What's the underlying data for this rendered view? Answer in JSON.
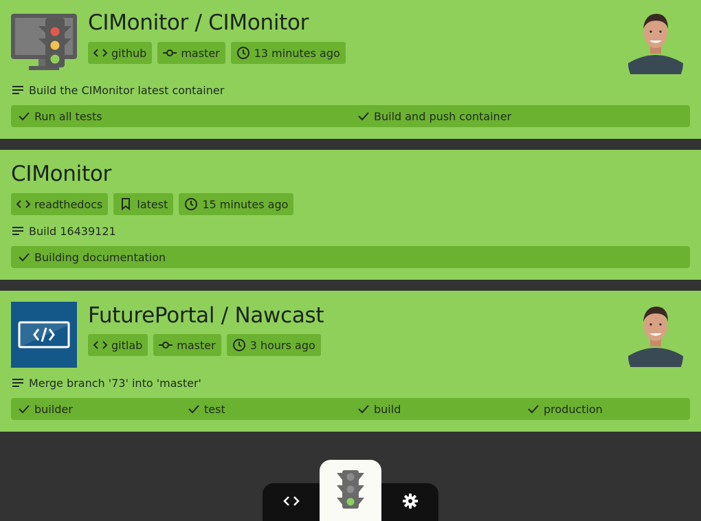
{
  "colors": {
    "card_bg": "#8fd05b",
    "chip_bg": "#6cb231",
    "page_bg": "#333333",
    "nav_bg": "#111111",
    "nav_active_bg": "#fbfbf5"
  },
  "builds": [
    {
      "logo_icon": "monitor-traffic-light-icon",
      "title": "CIMonitor / CIMonitor",
      "source": "github",
      "branch": "master",
      "time": "13 minutes ago",
      "message": "Build the CIMonitor latest container",
      "stages": [
        "Run all tests",
        "Build and push container"
      ],
      "status": "success"
    },
    {
      "title": "CIMonitor",
      "source": "readthedocs",
      "version": "latest",
      "time": "15 minutes ago",
      "message": "Build 16439121",
      "stages": [
        "Building documentation"
      ],
      "status": "success"
    },
    {
      "logo_icon": "code-window-icon",
      "title": "FuturePortal / Nawcast",
      "source": "gitlab",
      "branch": "master",
      "time": "3 hours ago",
      "message": "Merge branch '73' into 'master'",
      "stages": [
        "builder",
        "test",
        "build",
        "production"
      ],
      "status": "success"
    }
  ],
  "nav": {
    "items": [
      {
        "icon": "code-icon",
        "active": false
      },
      {
        "icon": "traffic-light-icon",
        "active": true
      },
      {
        "icon": "gear-icon",
        "active": false
      }
    ]
  }
}
